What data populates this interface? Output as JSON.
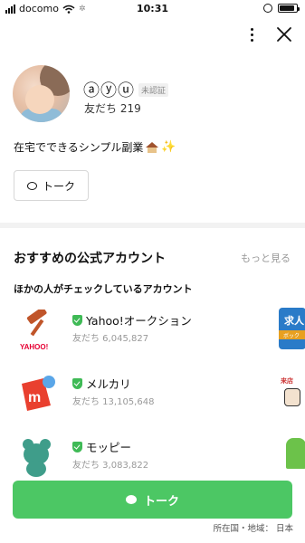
{
  "status_bar": {
    "carrier": "docomo",
    "time": "10:31",
    "battery_level": 0.9
  },
  "profile": {
    "name": "ⓐⓨⓤ",
    "verify_badge": "未認証",
    "friends_label": "友だち 219",
    "status_message": "在宅でできるシンプル副業",
    "talk_label": "トーク"
  },
  "recommend": {
    "title": "おすすめの公式アカウント",
    "see_more": "もっと見る",
    "subtitle": "ほかの人がチェックしているアカウント",
    "accounts": [
      {
        "name": "Yahoo!オークション",
        "friends": "友だち 6,045,827",
        "icon": "yahoo-auction-gavel-icon"
      },
      {
        "name": "メルカリ",
        "friends": "友だち 13,105,648",
        "icon": "mercari-icon"
      },
      {
        "name": "モッピー",
        "friends": "友だち 3,083,822",
        "icon": "moppy-icon"
      }
    ],
    "peek_texts": [
      "求人",
      "ボック",
      "来店"
    ]
  },
  "bottom": {
    "talk_label": "トーク",
    "country": "所在国・地域： 日本"
  },
  "colors": {
    "line_green": "#4cc764",
    "verified_green": "#3fba56"
  }
}
